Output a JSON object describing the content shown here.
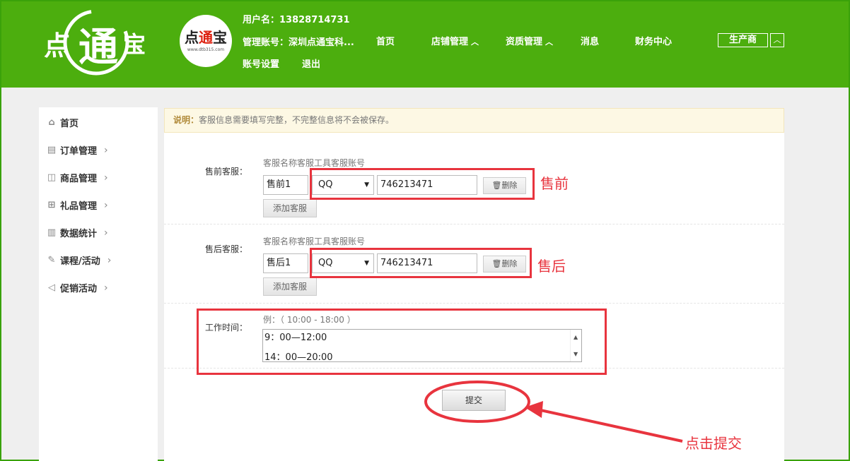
{
  "header": {
    "username_label": "用户名：13828714731",
    "account_label": "管理账号：深圳点通宝科...",
    "logo_text": "点通宝",
    "logo_mini_url": "www.dtb315.com",
    "nav": [
      {
        "label": "首页"
      },
      {
        "label": "店铺管理",
        "chevron": "^"
      },
      {
        "label": "资质管理",
        "chevron": "^"
      },
      {
        "label": "消息"
      },
      {
        "label": "财务中心"
      }
    ],
    "nav_row2": [
      {
        "label": "账号设置"
      },
      {
        "label": "退出"
      }
    ],
    "role": "生产商",
    "role_toggle_icon": "chevron-up-icon"
  },
  "sidebar": {
    "items": [
      {
        "label": "首页",
        "icon": "home-icon",
        "arrow": ""
      },
      {
        "label": "订单管理",
        "icon": "document-icon",
        "arrow": "›"
      },
      {
        "label": "商品管理",
        "icon": "bag-icon",
        "arrow": "›"
      },
      {
        "label": "礼品管理",
        "icon": "gift-icon",
        "arrow": "›"
      },
      {
        "label": "数据统计",
        "icon": "chart-icon",
        "arrow": "›"
      },
      {
        "label": "课程/活动",
        "icon": "course-icon",
        "arrow": "›"
      },
      {
        "label": "促销活动",
        "icon": "megaphone-icon",
        "arrow": "›"
      }
    ]
  },
  "notice": {
    "prefix": "说明：",
    "text": "客服信息需要填写完整，不完整信息将不会被保存。"
  },
  "presale": {
    "label": "售前客服：",
    "columns": "客服名称客服工具客服账号",
    "name": "售前1",
    "tool": "QQ",
    "account": "746213471",
    "delete_label": "删除",
    "add_label": "添加客服"
  },
  "aftersale": {
    "label": "售后客服：",
    "columns": "客服名称客服工具客服账号",
    "name": "售后1",
    "tool": "QQ",
    "account": "746213471",
    "delete_label": "删除",
    "add_label": "添加客服"
  },
  "worktime": {
    "label": "工作时间：",
    "example": "例：（ 10:00 - 18:00 ）",
    "lines": [
      "9：00—12:00",
      "14：00—20:00"
    ]
  },
  "submit_label": "提交",
  "annotations": {
    "presale": "售前",
    "aftersale": "售后",
    "submit": "点击提交"
  },
  "colors": {
    "brand_green": "#4cae0e",
    "annotation_red": "#e8343e"
  }
}
